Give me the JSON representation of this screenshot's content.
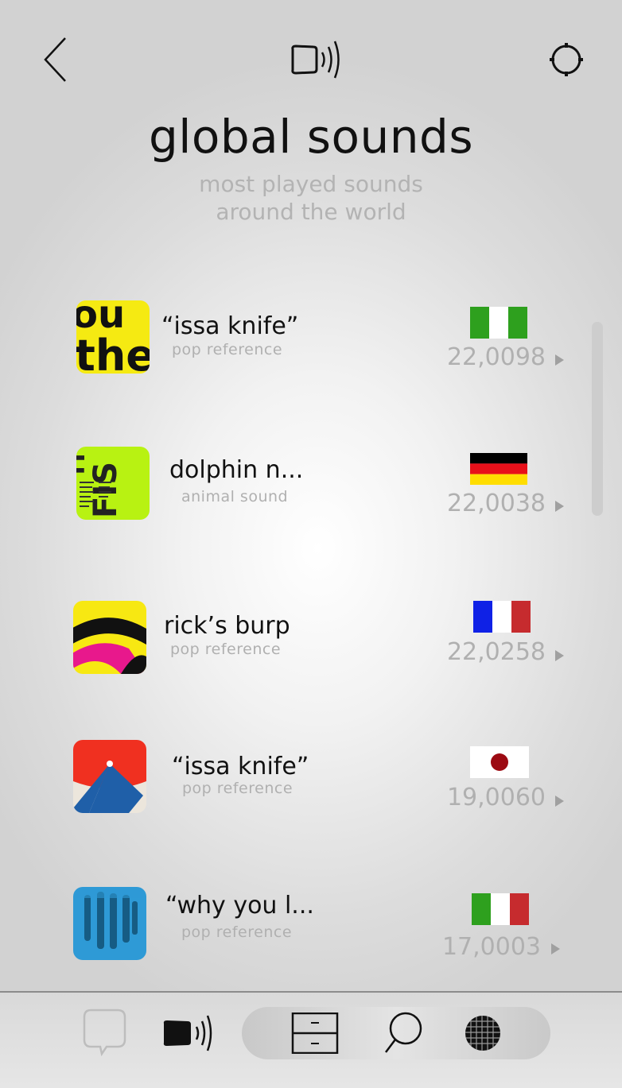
{
  "header": {
    "back_icon": "chevron-left-icon",
    "center_icon": "speaker-sound-icon",
    "settings_icon": "settings-ring-icon"
  },
  "page": {
    "title": "global sounds",
    "subtitle_line1": "most played sounds",
    "subtitle_line2": "around the world"
  },
  "sounds": [
    {
      "title": "“issa knife”",
      "category": "pop reference",
      "country_flag": "nigeria",
      "plays": "22,0098"
    },
    {
      "title": "dolphin n...",
      "category": "animal sound",
      "country_flag": "germany",
      "plays": "22,0038"
    },
    {
      "title": "rick’s burp",
      "category": "pop reference",
      "country_flag": "france",
      "plays": "22,0258"
    },
    {
      "title": "“issa knife”",
      "category": "pop reference",
      "country_flag": "japan",
      "plays": "19,0060"
    },
    {
      "title": "“why you l...",
      "category": "pop reference",
      "country_flag": "italy",
      "plays": "17,0003"
    }
  ],
  "tabbar": {
    "items": [
      "chat-bubble-icon",
      "speaker-sound-icon",
      "drawer-cabinet-icon",
      "search-icon",
      "globe-grid-icon"
    ],
    "active": "speaker-sound-icon"
  },
  "colors": {
    "flag_green": "#2ea01e",
    "flag_red": "#c62b2e",
    "flag_blue": "#0f21e6",
    "flag_gold": "#ffdd00",
    "japan_red": "#9c0a12"
  }
}
